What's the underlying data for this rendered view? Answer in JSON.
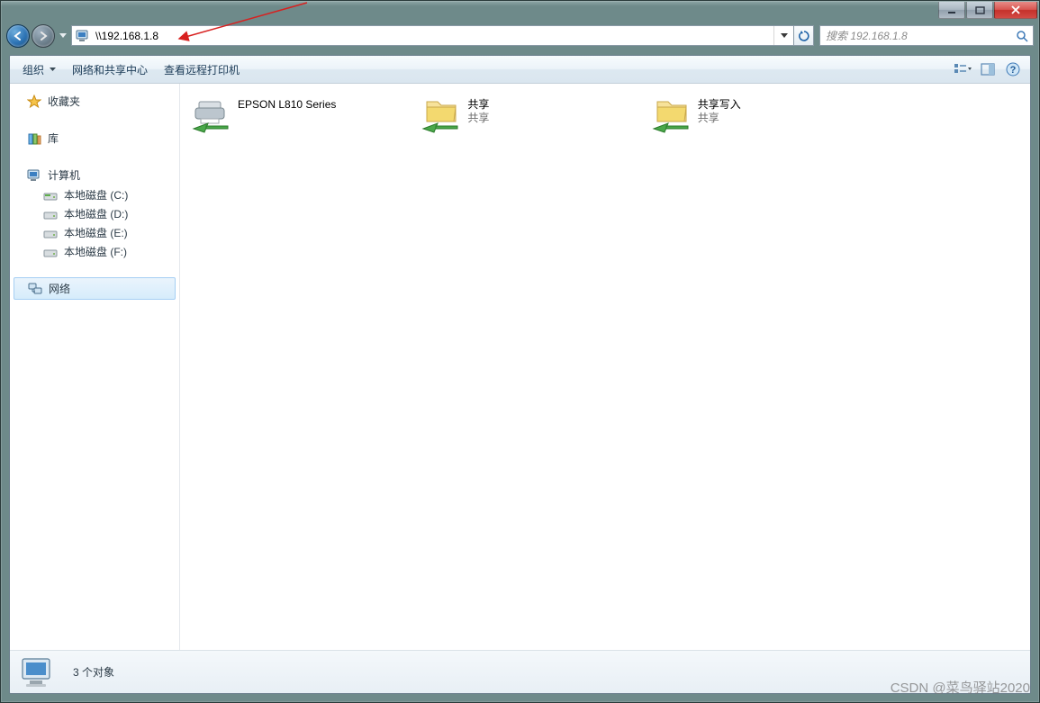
{
  "address": {
    "path": "\\\\192.168.1.8"
  },
  "search": {
    "placeholder": "搜索 192.168.1.8"
  },
  "toolbar": {
    "organize": "组织",
    "network_center": "网络和共享中心",
    "view_printers": "查看远程打印机"
  },
  "sidebar": {
    "favorites": "收藏夹",
    "libraries": "库",
    "computer": "计算机",
    "drives": [
      "本地磁盘 (C:)",
      "本地磁盘 (D:)",
      "本地磁盘 (E:)",
      "本地磁盘 (F:)"
    ],
    "network": "网络"
  },
  "items": [
    {
      "name": "EPSON L810 Series",
      "sub": "",
      "icon": "printer"
    },
    {
      "name": "共享",
      "sub": "共享",
      "icon": "share"
    },
    {
      "name": "共享写入",
      "sub": "共享",
      "icon": "share"
    }
  ],
  "status": {
    "text": "3 个对象"
  },
  "watermark": "CSDN @菜鸟驿站2020"
}
